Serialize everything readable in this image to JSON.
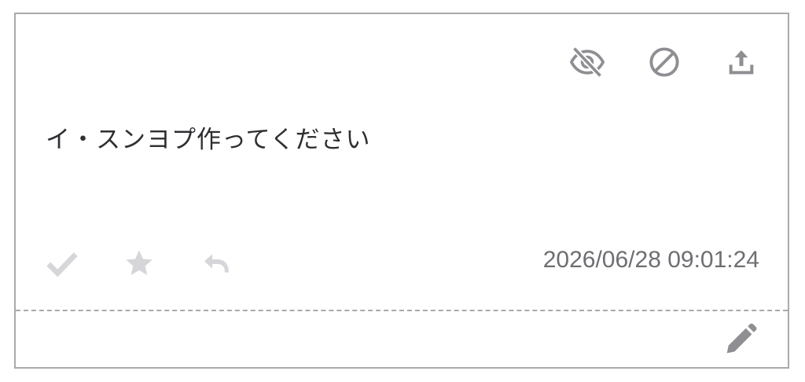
{
  "message": {
    "text": "イ・スンヨプ作ってください",
    "timestamp": "2026/06/28 09:01:24"
  },
  "icons": {
    "hide": "eye-off-icon",
    "block": "block-icon",
    "share": "upload-icon",
    "check": "check-icon",
    "star": "star-icon",
    "reply": "reply-icon",
    "edit": "pencil-icon"
  },
  "colors": {
    "border": "#a9a9ae",
    "icon_dark": "#8e8e93",
    "icon_light": "#d6d6da",
    "text": "#2f2f33",
    "timestamp": "#6e6e73"
  }
}
